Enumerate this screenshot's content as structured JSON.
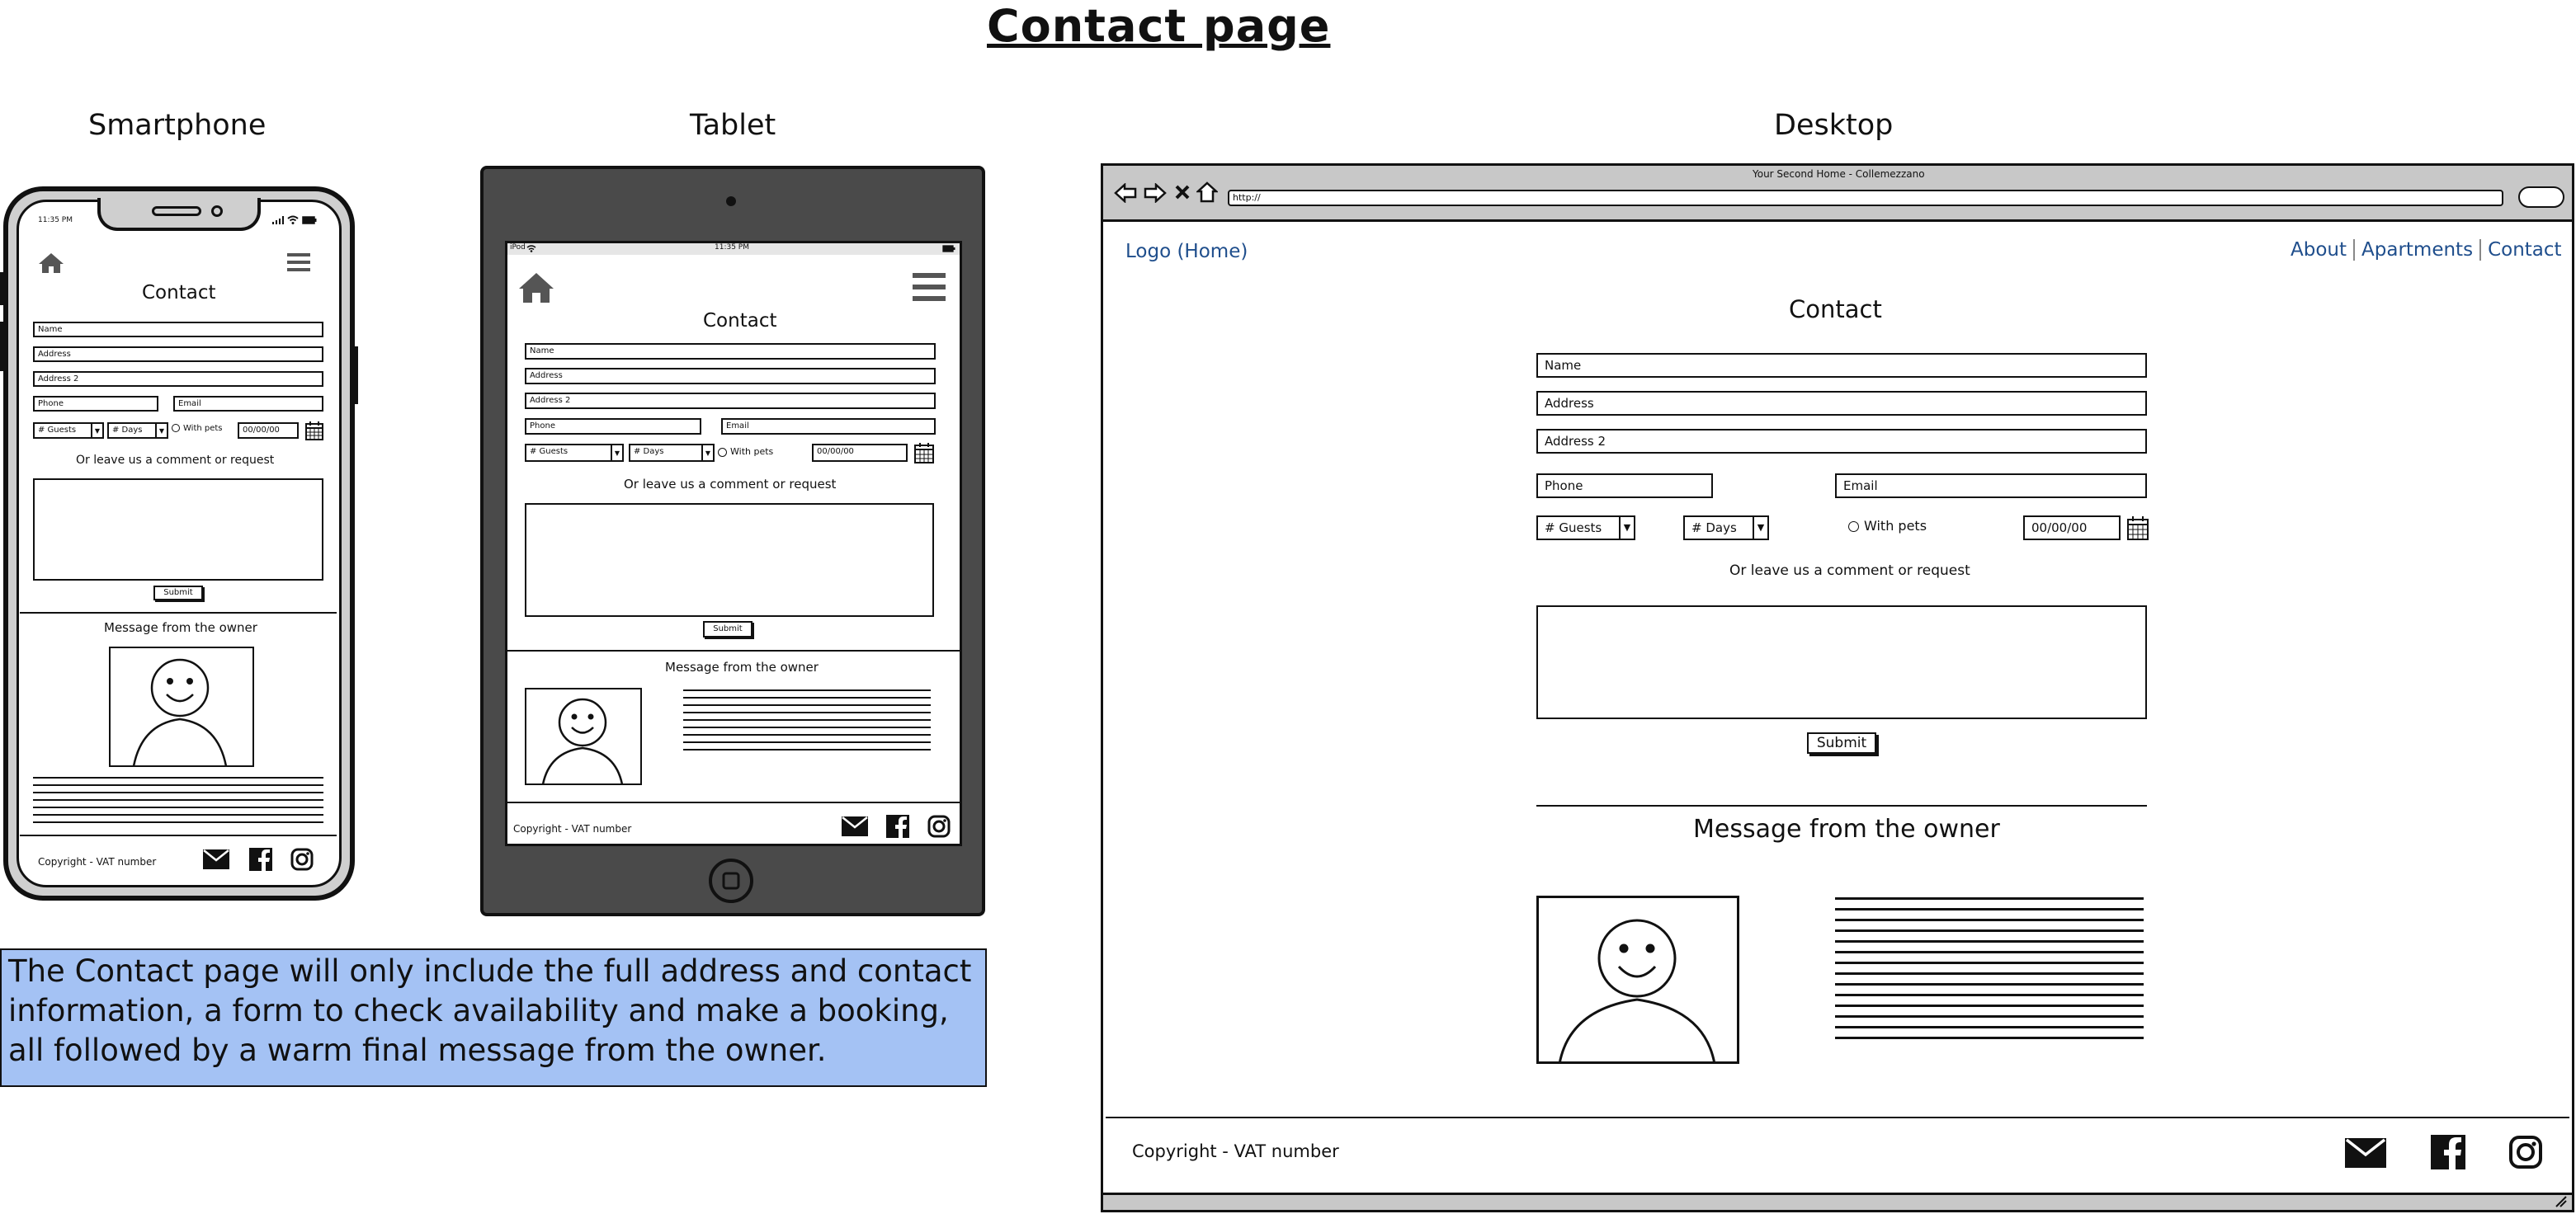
{
  "page_title": "Contact page",
  "devices": {
    "smartphone": "Smartphone",
    "tablet": "Tablet",
    "desktop": "Desktop"
  },
  "smartphone": {
    "status_time": "11:35 PM",
    "heading": "Contact",
    "fields": {
      "name": "Name",
      "address": "Address",
      "address2": "Address 2",
      "phone": "Phone",
      "email": "Email",
      "guests": "# Guests",
      "days": "# Days",
      "with_pets": "With pets",
      "date": "00/00/00"
    },
    "comment_label": "Or leave us a comment or request",
    "submit": "Submit",
    "owner_heading": "Message from the owner",
    "footer_copyright": "Copyright - VAT number"
  },
  "tablet": {
    "status_device": "iPod",
    "status_time": "11:35 PM",
    "heading": "Contact",
    "fields": {
      "name": "Name",
      "address": "Address",
      "address2": "Address 2",
      "phone": "Phone",
      "email": "Email",
      "guests": "# Guests",
      "days": "# Days",
      "with_pets": "With pets",
      "date": "00/00/00"
    },
    "comment_label": "Or leave us a comment or request",
    "submit": "Submit",
    "owner_heading": "Message from the owner",
    "footer_copyright": "Copyright - VAT number"
  },
  "desktop": {
    "window_title": "Your Second Home - Collemezzano",
    "url": "http://",
    "logo": "Logo (Home)",
    "nav": [
      "About",
      "Apartments",
      "Contact"
    ],
    "heading": "Contact",
    "fields": {
      "name": "Name",
      "address": "Address",
      "address2": "Address 2",
      "phone": "Phone",
      "email": "Email",
      "guests": "# Guests",
      "days": "# Days",
      "with_pets": "With pets",
      "date": "00/00/00"
    },
    "comment_label": "Or leave us a comment or request",
    "submit": "Submit",
    "owner_heading": "Message from the owner",
    "footer_copyright": "Copyright - VAT number"
  },
  "note": "The Contact page will only include the full address and contact information, a form to check availability and make a booking, all followed by a warm final message from the owner.",
  "colors": {
    "note_bg": "#a4c2f4",
    "tablet_frame": "#4a4a4a",
    "browser_chrome": "#c8c8c8",
    "link": "#1f4e8c"
  },
  "icons": [
    "home-icon",
    "hamburger-menu-icon",
    "calendar-icon",
    "avatar-sketch-icon",
    "mail-icon",
    "facebook-icon",
    "instagram-icon",
    "back-arrow-icon",
    "forward-arrow-icon",
    "close-icon",
    "home-outline-icon",
    "search-icon",
    "wifi-icon",
    "signal-icon",
    "battery-icon",
    "camera-icon",
    "home-button-icon"
  ]
}
